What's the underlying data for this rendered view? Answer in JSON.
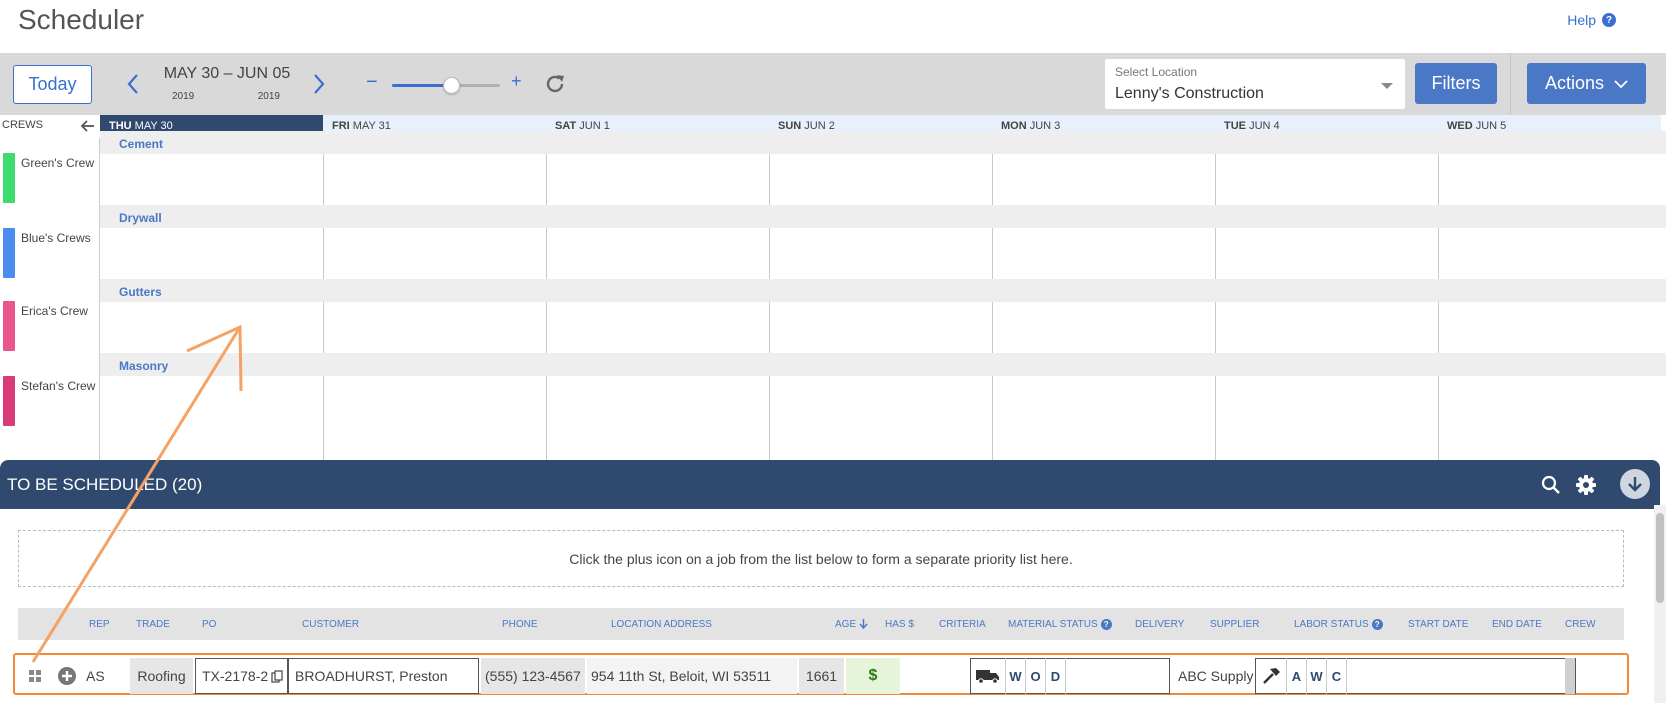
{
  "app": {
    "title": "Scheduler",
    "help_label": "Help",
    "help_glyph": "?"
  },
  "toolbar": {
    "today_label": "Today",
    "date_range": "MAY 30 – JUN 05",
    "year_start": "2019",
    "year_end": "2019",
    "zoom_minus": "−",
    "zoom_plus": "+",
    "zoom_level": 0.55,
    "location": {
      "label": "Select Location",
      "value": "Lenny's Construction"
    },
    "filters_label": "Filters",
    "actions_label": "Actions"
  },
  "calendar": {
    "crews_label": "CREWS",
    "days": [
      {
        "dow": "THU",
        "date": "MAY 30",
        "active": true
      },
      {
        "dow": "FRI",
        "date": "MAY 31",
        "active": false
      },
      {
        "dow": "SAT",
        "date": "JUN 1",
        "active": false
      },
      {
        "dow": "SUN",
        "date": "JUN 2",
        "active": false
      },
      {
        "dow": "MON",
        "date": "JUN 3",
        "active": false
      },
      {
        "dow": "TUE",
        "date": "JUN 4",
        "active": false
      },
      {
        "dow": "WED",
        "date": "JUN 5",
        "active": false
      }
    ],
    "groups": [
      {
        "trade": "Cement",
        "crew": "Green's Crew",
        "color": "#3ddc6e"
      },
      {
        "trade": "Drywall",
        "crew": "Blue's Crews",
        "color": "#4a8cf0"
      },
      {
        "trade": "Gutters",
        "crew": "Erica's Crew",
        "color": "#e9568c"
      },
      {
        "trade": "Masonry",
        "crew": "Stefan's Crew",
        "color": "#d93a78"
      }
    ]
  },
  "queue": {
    "title": "TO BE SCHEDULED (20)",
    "priority_hint": "Click the plus icon on a job from the list below to form a separate priority list here.",
    "columns": {
      "rep": "REP",
      "trade": "TRADE",
      "po": "PO",
      "customer": "CUSTOMER",
      "phone": "PHONE",
      "address": "LOCATION ADDRESS",
      "age": "AGE",
      "has": "HAS $",
      "criteria": "CRITERIA",
      "material_status": "MATERIAL STATUS",
      "delivery": "DELIVERY",
      "supplier": "SUPPLIER",
      "labor_status": "LABOR STATUS",
      "start_date": "START DATE",
      "end_date": "END DATE",
      "crew": "CREW"
    },
    "job": {
      "rep": "AS",
      "trade": "Roofing",
      "po": "TX-2178-2",
      "customer": "BROADHURST, Preston",
      "phone": "(555) 123-4567",
      "address": "954 11th St, Beloit, WI 53511",
      "age": "1661",
      "has": "$",
      "material_letters": [
        "W",
        "O",
        "D"
      ],
      "supplier": "ABC Supply",
      "labor_letters": [
        "A",
        "W",
        "C"
      ]
    }
  },
  "colors": {
    "accent": "#4a78c6",
    "navy": "#2f4a6e",
    "highlight": "#f08a3a"
  }
}
